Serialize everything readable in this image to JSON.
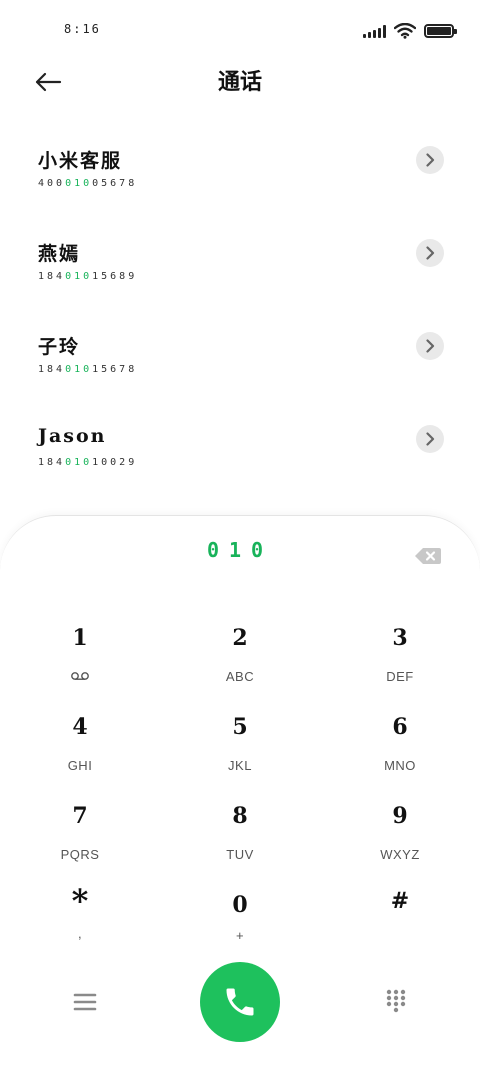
{
  "status_bar": {
    "time": "8:16",
    "battery_level": 1.0
  },
  "header": {
    "title": "通话"
  },
  "contacts": [
    {
      "name": "小米客服",
      "number_prefix": "400",
      "number_match": "010",
      "number_suffix": "05678"
    },
    {
      "name": "燕嫣",
      "number_prefix": "184",
      "number_match": "010",
      "number_suffix": "15689"
    },
    {
      "name": "子玲",
      "number_prefix": "184",
      "number_match": "010",
      "number_suffix": "15678"
    },
    {
      "name": "Jason",
      "number_prefix": "184",
      "number_match": "010",
      "number_suffix": "10029"
    }
  ],
  "dialer": {
    "input": "010",
    "keys": [
      {
        "digit": "1",
        "letters": ""
      },
      {
        "digit": "2",
        "letters": "ABC"
      },
      {
        "digit": "3",
        "letters": "DEF"
      },
      {
        "digit": "4",
        "letters": "GHI"
      },
      {
        "digit": "5",
        "letters": "JKL"
      },
      {
        "digit": "6",
        "letters": "MNO"
      },
      {
        "digit": "7",
        "letters": "PQRS"
      },
      {
        "digit": "8",
        "letters": "TUV"
      },
      {
        "digit": "9",
        "letters": "WXYZ"
      },
      {
        "digit": "*",
        "letters": ","
      },
      {
        "digit": "0",
        "letters": "+"
      },
      {
        "digit": "#",
        "letters": ""
      }
    ]
  },
  "icons": {
    "back": "arrow-left-icon",
    "detail": "chevron-right-icon",
    "backspace": "backspace-icon",
    "voicemail": "voicemail-icon",
    "menu": "hamburger-menu-icon",
    "call": "phone-icon",
    "keypad": "dialpad-icon"
  },
  "colors": {
    "accent": "#18b35a",
    "call_button": "#1ec15d",
    "detail_button_bg": "#e9e9e9"
  }
}
